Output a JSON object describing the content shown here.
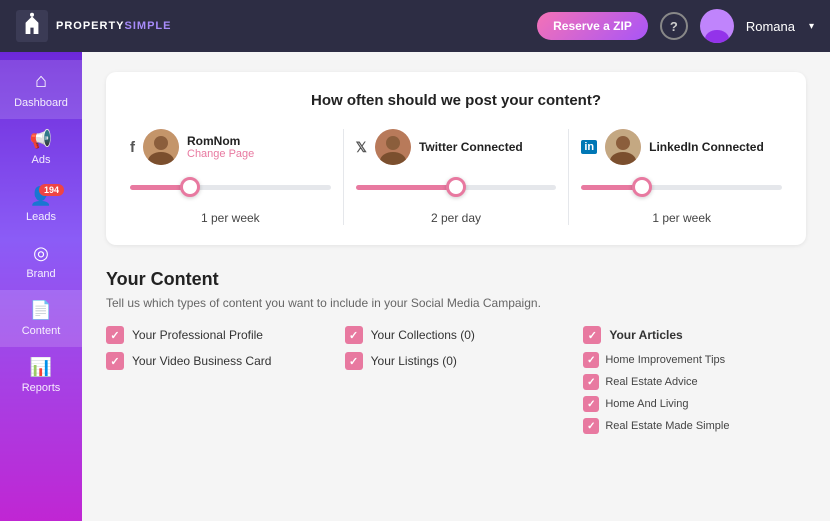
{
  "navbar": {
    "logo_text_property": "PROPERTY",
    "logo_text_simple": "SIMPLE",
    "reserve_btn": "Reserve a ZIP",
    "help_label": "?",
    "username": "Romana",
    "chevron": "▾"
  },
  "sidebar": {
    "items": [
      {
        "id": "dashboard",
        "label": "Dashboard",
        "icon": "⌂",
        "active": true
      },
      {
        "id": "ads",
        "label": "Ads",
        "icon": "📢",
        "active": false
      },
      {
        "id": "leads",
        "label": "Leads",
        "icon": "👤",
        "badge": "194",
        "active": false
      },
      {
        "id": "brand",
        "label": "Brand",
        "icon": "◎",
        "active": false
      },
      {
        "id": "content",
        "label": "Content",
        "icon": "📄",
        "active": true
      },
      {
        "id": "reports",
        "label": "Reports",
        "icon": "📊",
        "active": false
      }
    ]
  },
  "frequency_card": {
    "title": "How often should we post your content?",
    "accounts": [
      {
        "platform": "f",
        "name": "RomNom",
        "sub": "Change Page",
        "freq_label": "1 per week",
        "slider_pos": "pos1"
      },
      {
        "platform": "t",
        "name": "Twitter Connected",
        "sub": null,
        "freq_label": "2 per day",
        "slider_pos": "pos2"
      },
      {
        "platform": "in",
        "name": "LinkedIn Connected",
        "sub": null,
        "freq_label": "1 per week",
        "slider_pos": "pos3"
      }
    ]
  },
  "your_content": {
    "title": "Your Content",
    "subtitle": "Tell us which types of content you want to include in your Social Media Campaign.",
    "col1": [
      {
        "label": "Your Professional Profile",
        "checked": true
      },
      {
        "label": "Your Video Business Card",
        "checked": true
      }
    ],
    "col2": [
      {
        "label": "Your Collections (0)",
        "checked": true
      },
      {
        "label": "Your Listings (0)",
        "checked": true
      }
    ],
    "col3": {
      "articles_label": "Your Articles",
      "sub_items": [
        {
          "label": "Home Improvement Tips",
          "checked": true
        },
        {
          "label": "Real Estate Advice",
          "checked": true
        },
        {
          "label": "Home And Living",
          "checked": true
        },
        {
          "label": "Real Estate Made Simple",
          "checked": true
        }
      ]
    }
  }
}
